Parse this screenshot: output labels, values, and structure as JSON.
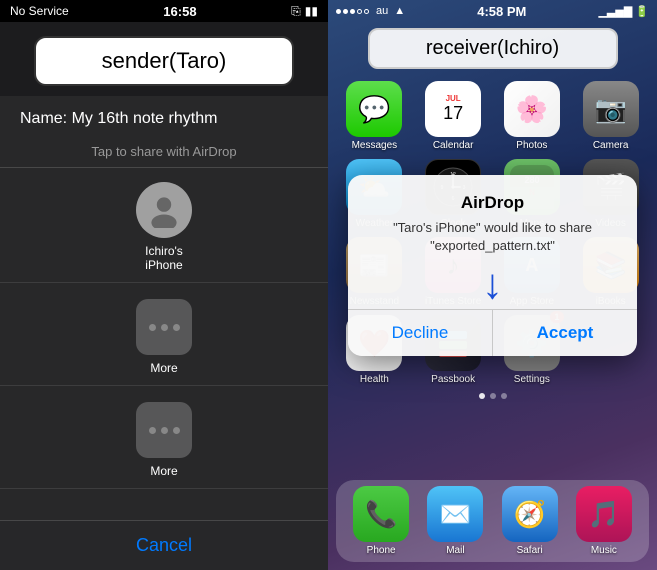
{
  "left": {
    "status": {
      "carrier": "No Service",
      "time": "16:58",
      "signal": "▼"
    },
    "sender_label": "sender(Taro)",
    "name_prefix": "Name:",
    "name_value": "My 16th note rhythm",
    "airdrop_hint": "Tap to share with AirDrop",
    "contacts": [
      {
        "name": "Ichiro's\niPhone"
      }
    ],
    "more_items": [
      {
        "label": "More"
      },
      {
        "label": "More"
      }
    ],
    "cancel": "Cancel"
  },
  "right": {
    "status": {
      "carrier": "au",
      "time": "4:58 PM",
      "wifi": true
    },
    "receiver_label": "receiver(Ichiro)",
    "apps_row1": [
      {
        "label": "Messages",
        "color_class": "app-messages",
        "icon": "💬"
      },
      {
        "label": "Calendar",
        "color_class": "app-calendar",
        "icon": "📅"
      },
      {
        "label": "Photos",
        "color_class": "app-photos",
        "icon": "🌸"
      },
      {
        "label": "Camera",
        "color_class": "app-camera",
        "icon": "📷"
      }
    ],
    "apps_row2": [
      {
        "label": "Weather",
        "color_class": "app-weather",
        "icon": "⛅"
      },
      {
        "label": "Clock",
        "color_class": "app-clock",
        "icon": "🕐"
      },
      {
        "label": "Maps",
        "color_class": "app-maps",
        "icon": "🗺"
      },
      {
        "label": "Videos",
        "color_class": "app-videos",
        "icon": "🎬"
      }
    ],
    "apps_row3": [
      {
        "label": "Newsstand",
        "color_class": "app-newsstand",
        "icon": "📰"
      },
      {
        "label": "iTunes Store",
        "color_class": "app-itunes",
        "icon": "🎵"
      },
      {
        "label": "App Store",
        "color_class": "app-appstore",
        "icon": "A"
      },
      {
        "label": "iBooks",
        "color_class": "app-ibooks",
        "icon": "📚"
      }
    ],
    "apps_row4": [
      {
        "label": "Health",
        "color_class": "app-health",
        "icon": "❤️"
      },
      {
        "label": "Passbook",
        "color_class": "app-passbook",
        "icon": "💳"
      },
      {
        "label": "Settings",
        "color_class": "app-settings",
        "icon": "⚙️",
        "badge": "1"
      }
    ],
    "dock": [
      {
        "label": "Phone",
        "color_class": "app-phone",
        "icon": "📞"
      },
      {
        "label": "Mail",
        "color_class": "app-mail",
        "icon": "✉️"
      },
      {
        "label": "Safari",
        "color_class": "app-safari",
        "icon": "🧭"
      },
      {
        "label": "Music",
        "color_class": "app-music",
        "icon": "🎵"
      }
    ],
    "dialog": {
      "title": "AirDrop",
      "message": "\"Taro's iPhone\" would like to share\n\"exported_pattern.txt\"",
      "decline_label": "Decline",
      "accept_label": "Accept"
    }
  }
}
